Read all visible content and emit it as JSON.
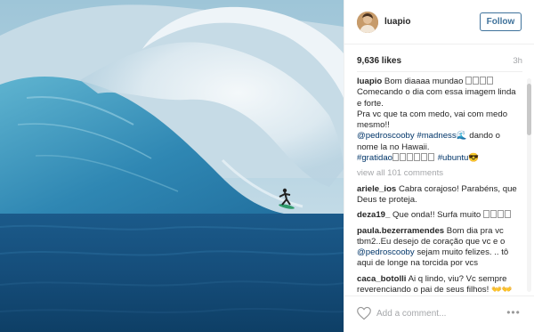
{
  "post": {
    "username": "luapio",
    "follow_label": "Follow",
    "likes": "9,636 likes",
    "time": "3h"
  },
  "caption": {
    "user": "luapio",
    "line1": "Bom diaaaa mundao",
    "line2": "Comecando o dia com essa imagem linda e forte.",
    "line3": "Pra vc que ta com medo, vai com medo mesmo!!",
    "mention": "@pedroscooby",
    "tag_madness": "#madness",
    "text_after": "dando o nome la no Hawaii.",
    "tag_gratidao": "#gratidao",
    "tag_ubuntu": "#ubuntu"
  },
  "view_all": "view all 101 comments",
  "comments": [
    {
      "user": "ariele_ios",
      "text": "Cabra corajoso! Parabéns, que Deus te proteja."
    },
    {
      "user": "deza19_",
      "text": "Que onda!! Surfa muito"
    },
    {
      "user": "paula.bezerramendes",
      "text_before": "Bom dia pra vc tbm2..Eu desejo de coração que vc e o",
      "mention": "@pedroscooby",
      "text_after": "sejam muito felizes. .. tô aqui de longe na torcida por vcs"
    },
    {
      "user": "caca_botolli",
      "text": "Ai q lindo, viu? Vc sempre reverenciando o pai de seus filhos!"
    }
  ],
  "footer": {
    "placeholder": "Add a comment...",
    "more_label": "•••"
  },
  "icons": {
    "like": "heart-outline-icon",
    "more": "more-dots-icon"
  },
  "colors": {
    "follow_blue": "#3f729b",
    "link_blue": "#003569",
    "muted_gray": "#a5a7aa",
    "divider": "#efefef"
  }
}
